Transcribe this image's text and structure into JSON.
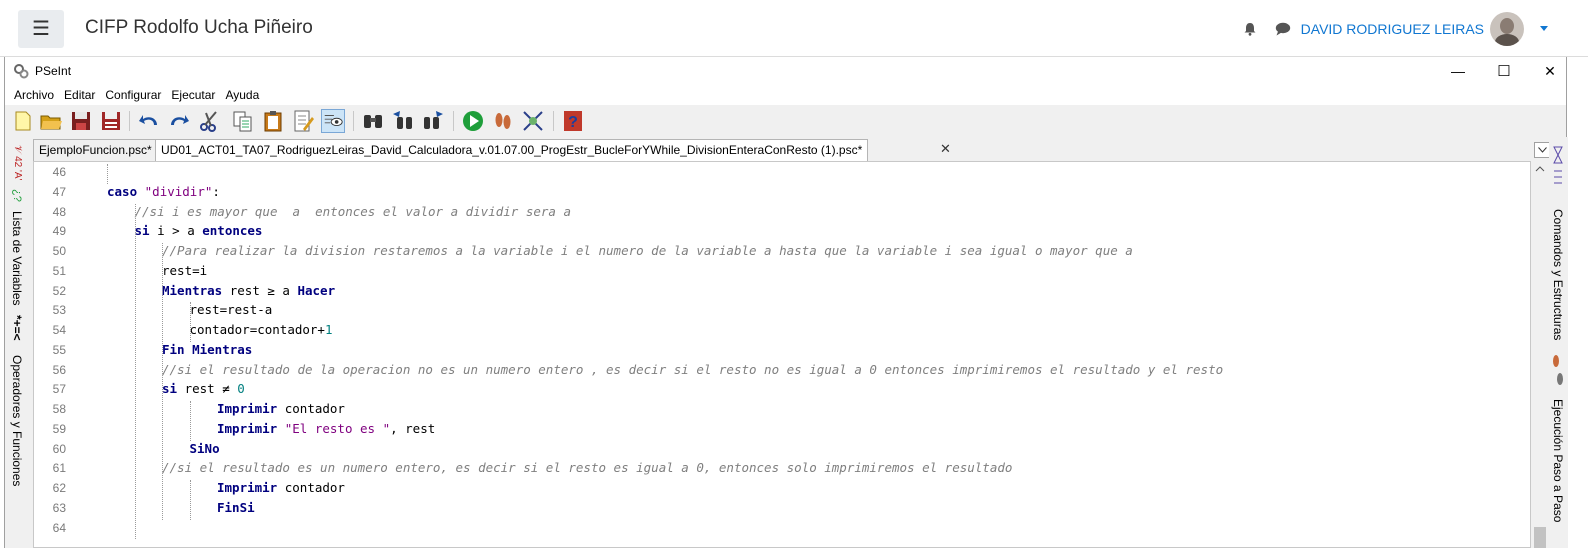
{
  "moodle": {
    "site_title": "CIFP Rodolfo Ucha Piñeiro",
    "user_name": "DAVID RODRIGUEZ LEIRAS",
    "menu_icon": "hamburger-icon",
    "notif_icon": "bell-icon",
    "msg_icon": "chat-icon",
    "accent": "#1177d1"
  },
  "window": {
    "title": "PSeInt",
    "minimize": "—",
    "maximize": "☐",
    "close": "✕"
  },
  "menu": [
    "Archivo",
    "Editar",
    "Configurar",
    "Ejecutar",
    "Ayuda"
  ],
  "toolbar": [
    "new-file-icon",
    "open-file-icon",
    "save-icon",
    "save-as-icon",
    "undo-icon",
    "redo-icon",
    "cut-icon",
    "copy-icon",
    "paste-icon",
    "edit-icon",
    "toggle-view-icon",
    "search-icon",
    "search-prev-icon",
    "search-next-icon",
    "run-icon",
    "step-icon",
    "draw-flowchart-icon",
    "help-icon"
  ],
  "tabs": [
    {
      "label": "EjemploFuncion.psc*"
    },
    {
      "label": "UD01_ACT01_TA07_RodriguezLeiras_David_Calculadora_v.01.07.00_ProgEstr_BucleForYWhile_DivisionEnteraConResto (1).psc*",
      "close": "✕"
    }
  ],
  "left_panel": {
    "variables_label": "Lista de Variables",
    "operators_label": "Operadores y Funciones",
    "variables_glyphs": "*+=<",
    "operators_glyphs": "¿?"
  },
  "right_panel": {
    "commands_label": "Comandos y Estructuras",
    "step_label": "Ejecución Paso a Paso"
  },
  "code": [
    {
      "n": "46",
      "indent": 0,
      "tokens": []
    },
    {
      "n": "47",
      "indent": 0,
      "tokens": [
        {
          "t": "kw",
          "v": "caso"
        },
        {
          "t": "plain",
          "v": " "
        },
        {
          "t": "str",
          "v": "\"dividir\""
        },
        {
          "t": "plain",
          "v": ":"
        }
      ]
    },
    {
      "n": "48",
      "indent": 1,
      "tokens": [
        {
          "t": "cmt",
          "v": "//si i es mayor que  a  entonces el valor a dividir sera a"
        }
      ]
    },
    {
      "n": "49",
      "indent": 1,
      "tokens": [
        {
          "t": "kw",
          "v": "si"
        },
        {
          "t": "plain",
          "v": " i > a "
        },
        {
          "t": "kw",
          "v": "entonces"
        }
      ]
    },
    {
      "n": "50",
      "indent": 2,
      "tokens": [
        {
          "t": "cmt",
          "v": "//Para realizar la division restaremos a la variable i el numero de la variable a hasta que la variable i sea igual o mayor que a"
        }
      ]
    },
    {
      "n": "51",
      "indent": 2,
      "tokens": [
        {
          "t": "plain",
          "v": "rest=i"
        }
      ]
    },
    {
      "n": "52",
      "indent": 2,
      "tokens": [
        {
          "t": "kw",
          "v": "Mientras"
        },
        {
          "t": "plain",
          "v": " rest ≥ a "
        },
        {
          "t": "kw",
          "v": "Hacer"
        }
      ]
    },
    {
      "n": "53",
      "indent": 3,
      "tokens": [
        {
          "t": "plain",
          "v": "rest=rest-a"
        }
      ]
    },
    {
      "n": "54",
      "indent": 3,
      "tokens": [
        {
          "t": "plain",
          "v": "contador=contador+"
        },
        {
          "t": "num",
          "v": "1"
        }
      ]
    },
    {
      "n": "55",
      "indent": 2,
      "tokens": [
        {
          "t": "kw",
          "v": "Fin Mientras"
        }
      ]
    },
    {
      "n": "56",
      "indent": 2,
      "tokens": [
        {
          "t": "cmt",
          "v": "//si el resultado de la operacion no es un numero entero , es decir si el resto no es igual a 0 entonces imprimiremos el resultado y el resto"
        }
      ]
    },
    {
      "n": "57",
      "indent": 2,
      "tokens": [
        {
          "t": "kw",
          "v": "si"
        },
        {
          "t": "plain",
          "v": " rest ≠ "
        },
        {
          "t": "num",
          "v": "0"
        }
      ]
    },
    {
      "n": "58",
      "indent": 4,
      "tokens": [
        {
          "t": "kw",
          "v": "Imprimir"
        },
        {
          "t": "plain",
          "v": " contador"
        }
      ]
    },
    {
      "n": "59",
      "indent": 4,
      "tokens": [
        {
          "t": "kw",
          "v": "Imprimir"
        },
        {
          "t": "plain",
          "v": " "
        },
        {
          "t": "str",
          "v": "\"El resto es \""
        },
        {
          "t": "plain",
          "v": ", rest"
        }
      ]
    },
    {
      "n": "60",
      "indent": 3,
      "tokens": [
        {
          "t": "kw",
          "v": "SiNo"
        }
      ]
    },
    {
      "n": "61",
      "indent": 2,
      "tokens": [
        {
          "t": "cmt",
          "v": "//si el resultado es un numero entero, es decir si el resto es igual a 0, entonces solo imprimiremos el resultado"
        }
      ]
    },
    {
      "n": "62",
      "indent": 4,
      "tokens": [
        {
          "t": "kw",
          "v": "Imprimir"
        },
        {
          "t": "plain",
          "v": " contador"
        }
      ]
    },
    {
      "n": "63",
      "indent": 4,
      "tokens": [
        {
          "t": "kw",
          "v": "FinSi"
        }
      ]
    },
    {
      "n": "64",
      "indent": 0,
      "tokens": []
    }
  ]
}
